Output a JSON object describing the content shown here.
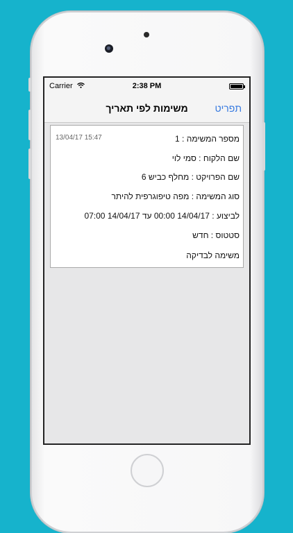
{
  "status_bar": {
    "carrier": "Carrier",
    "time": "2:38 PM"
  },
  "nav": {
    "title": "משימות לפי תאריך",
    "menu_label": "תפריט"
  },
  "task": {
    "timestamp": "13/04/17 15:47",
    "number": "מספר המשימה : 1",
    "customer": "שם הלקוח : סמי לוי",
    "project": "שם הפרויקט : מחלף כביש 6",
    "type": "סוג המשימה : מפה טיפוגרפית  להיתר",
    "execution": "לביצוע : 14/04/17 00:00 עד 14/04/17 07:00",
    "status": "סטטוס : חדש",
    "action": "משימה לבדיקה"
  },
  "colors": {
    "background": "#16b3cc",
    "link": "#3478e0",
    "screen_bg": "#e7e7e8"
  }
}
